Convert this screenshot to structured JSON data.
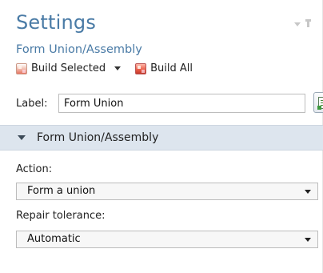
{
  "header": {
    "title": "Settings",
    "subtitle": "Form Union/Assembly"
  },
  "toolbar": {
    "build_selected_label": "Build Selected",
    "build_all_label": "Build All"
  },
  "label_row": {
    "label": "Label:",
    "value": "Form Union"
  },
  "section": {
    "title": "Form Union/Assembly",
    "fields": [
      {
        "label": "Action:",
        "value": "Form a union"
      },
      {
        "label": "Repair tolerance:",
        "value": "Automatic"
      }
    ]
  },
  "icons": {
    "build_selected": "build-selected-icon",
    "build_all": "build-all-icon",
    "notes": "notes-icon"
  }
}
